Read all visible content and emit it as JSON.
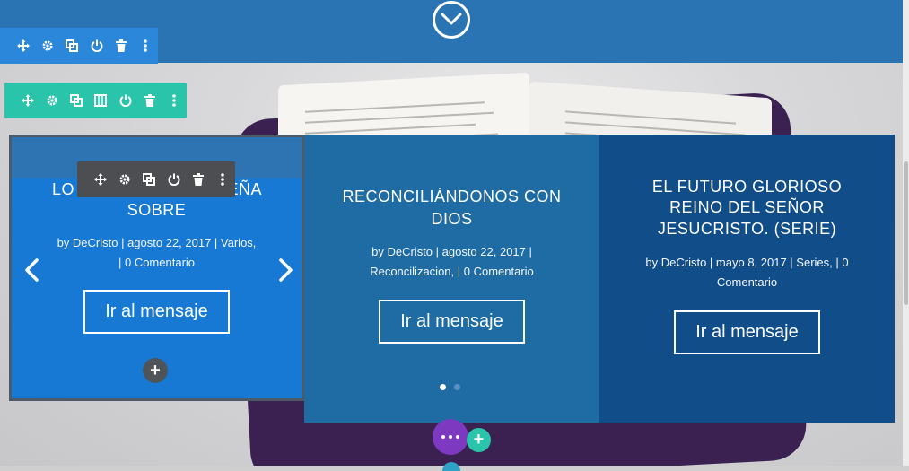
{
  "toolbars": {
    "section": [
      "move-icon",
      "gear-icon",
      "duplicate-icon",
      "power-icon",
      "trash-icon",
      "more-vertical-icon"
    ],
    "row": [
      "move-icon",
      "gear-icon",
      "duplicate-icon",
      "columns-icon",
      "power-icon",
      "trash-icon",
      "more-vertical-icon"
    ],
    "module": [
      "move-icon",
      "gear-icon",
      "duplicate-icon",
      "power-icon",
      "trash-icon",
      "more-vertical-icon"
    ]
  },
  "slides": [
    {
      "title_left": "LO",
      "title_right": "EÑA",
      "title_line2": "SOBRE",
      "meta_line1": "by DeCristo | agosto 22, 2017 | Varios,",
      "meta_line2": "| 0 Comentario",
      "button": "Ir al mensaje"
    },
    {
      "title_line1": "RECONCILIÁNDONOS CON",
      "title_line2": "DIOS",
      "meta_line1": "by DeCristo | agosto 22, 2017 |",
      "meta_line2": "Reconcilizacion, | 0 Comentario",
      "button": "Ir al mensaje"
    },
    {
      "title_line1": "EL FUTURO GLORIOSO",
      "title_line2": "REINO DEL SEÑOR",
      "title_line3": "JESUCRISTO. (SERIE)",
      "meta_line1": "by DeCristo | mayo 8, 2017 | Series, | 0",
      "meta_line2": "Comentario",
      "button": "Ir al mensaje"
    }
  ],
  "slider": {
    "active_dot": 1,
    "dot_count": 2
  },
  "builder": {
    "add_module": "+",
    "add_row": "+"
  },
  "colors": {
    "section_toolbar": "#2b87da",
    "row_toolbar": "#29c4a9",
    "module_toolbar": "#4d4e52",
    "more_button": "#7d3ac1"
  }
}
